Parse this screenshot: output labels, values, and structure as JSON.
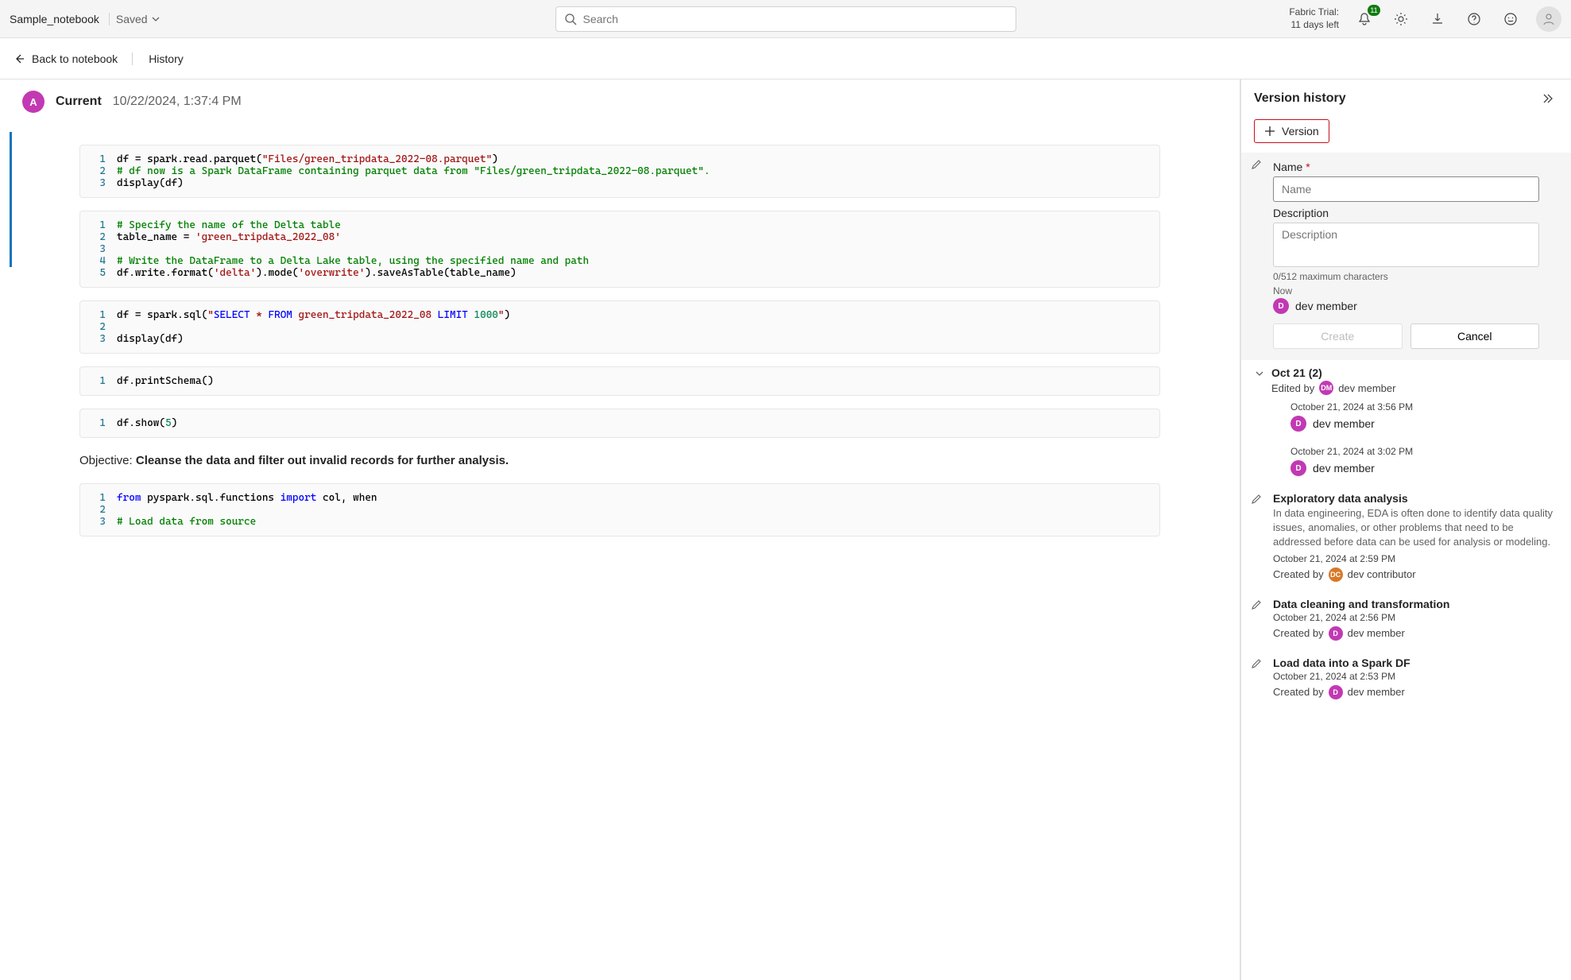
{
  "header": {
    "title": "Sample_notebook",
    "saved_label": "Saved",
    "search_placeholder": "Search",
    "trial_line1": "Fabric Trial:",
    "trial_line2": "11 days left",
    "notification_count": "11"
  },
  "secondary": {
    "back_label": "Back to notebook",
    "history_label": "History"
  },
  "current_version": {
    "avatar_letter": "A",
    "name": "Current",
    "timestamp": "10/22/2024, 1:37:4 PM"
  },
  "cells": [
    {
      "type": "code",
      "lines": [
        [
          {
            "t": "",
            "c": "df = spark.read.parquet("
          },
          {
            "t": "s",
            "c": "\"Files/green_tripdata_2022-08.parquet\""
          },
          {
            "t": "",
            "c": ")"
          }
        ],
        [
          {
            "t": "cm",
            "c": "# df now is a Spark DataFrame containing parquet data from \"Files/green_tripdata_2022-08.parquet\"."
          }
        ],
        [
          {
            "t": "",
            "c": "display(df)"
          }
        ]
      ]
    },
    {
      "type": "code",
      "lines": [
        [
          {
            "t": "cm",
            "c": "# Specify the name of the Delta table"
          }
        ],
        [
          {
            "t": "",
            "c": "table_name = "
          },
          {
            "t": "s",
            "c": "'green_tripdata_2022_08'"
          }
        ],
        [
          {
            "t": "",
            "c": ""
          }
        ],
        [
          {
            "t": "cm",
            "c": "# Write the DataFrame to a Delta Lake table, using the specified name and path"
          }
        ],
        [
          {
            "t": "",
            "c": "df.write.format("
          },
          {
            "t": "s",
            "c": "'delta'"
          },
          {
            "t": "",
            "c": ").mode("
          },
          {
            "t": "s",
            "c": "'overwrite'"
          },
          {
            "t": "",
            "c": ").saveAsTable(table_name)"
          }
        ]
      ]
    },
    {
      "type": "code",
      "lines": [
        [
          {
            "t": "",
            "c": "df = spark.sql("
          },
          {
            "t": "s",
            "c": "\""
          },
          {
            "t": "kw",
            "c": "SELECT"
          },
          {
            "t": "s",
            "c": " * "
          },
          {
            "t": "kw",
            "c": "FROM"
          },
          {
            "t": "s",
            "c": " green_tripdata_2022_08 "
          },
          {
            "t": "kw",
            "c": "LIMIT"
          },
          {
            "t": "s",
            "c": " "
          },
          {
            "t": "n",
            "c": "1000"
          },
          {
            "t": "s",
            "c": "\""
          },
          {
            "t": "",
            "c": ")"
          }
        ],
        [
          {
            "t": "",
            "c": ""
          }
        ],
        [
          {
            "t": "",
            "c": "display(df)"
          }
        ]
      ]
    },
    {
      "type": "code",
      "lines": [
        [
          {
            "t": "",
            "c": "df.printSchema()"
          }
        ]
      ]
    },
    {
      "type": "code",
      "lines": [
        [
          {
            "t": "",
            "c": "df.show("
          },
          {
            "t": "n",
            "c": "5"
          },
          {
            "t": "",
            "c": ")"
          }
        ]
      ]
    },
    {
      "type": "md",
      "objective_label": "Objective: ",
      "objective_value": "Cleanse the data and filter out invalid records for further analysis."
    },
    {
      "type": "code",
      "lines": [
        [
          {
            "t": "kw",
            "c": "from"
          },
          {
            "t": "",
            "c": " pyspark.sql.functions "
          },
          {
            "t": "kw",
            "c": "import"
          },
          {
            "t": "",
            "c": " col, when"
          }
        ],
        [
          {
            "t": "",
            "c": ""
          }
        ],
        [
          {
            "t": "cm",
            "c": "# Load data from source"
          }
        ]
      ]
    }
  ],
  "sidebar": {
    "title": "Version history",
    "add_version_label": "Version",
    "form": {
      "name_label": "Name",
      "name_placeholder": "Name",
      "desc_label": "Description",
      "desc_placeholder": "Description",
      "counter": "0/512 maximum characters",
      "now_label": "Now",
      "author_initial": "D",
      "author_name": "dev member",
      "create_label": "Create",
      "cancel_label": "Cancel"
    },
    "group": {
      "title": "Oct 21 (2)",
      "edited_by_label": "Edited by",
      "edited_initial": "DM",
      "edited_name": "dev member",
      "items": [
        {
          "ts": "October 21, 2024 at 3:56 PM",
          "initial": "D",
          "author": "dev member"
        },
        {
          "ts": "October 21, 2024 at 3:02 PM",
          "initial": "D",
          "author": "dev member"
        }
      ]
    },
    "named_versions": [
      {
        "title": "Exploratory data analysis",
        "desc": "In data engineering, EDA is often done to identify data quality issues, anomalies, or other problems that need to be addressed before data can be used for analysis or modeling.",
        "ts": "October 21, 2024 at 2:59 PM",
        "created_by_label": "Created by",
        "initial": "DC",
        "author": "dev contributor",
        "avatar_class": "av-orange"
      },
      {
        "title": "Data cleaning and transformation",
        "desc": "",
        "ts": "October 21, 2024 at 2:56 PM",
        "created_by_label": "Created by",
        "initial": "D",
        "author": "dev member",
        "avatar_class": "av-magenta"
      },
      {
        "title": "Load data into a Spark DF",
        "desc": "",
        "ts": "October 21, 2024 at 2:53 PM",
        "created_by_label": "Created by",
        "initial": "D",
        "author": "dev member",
        "avatar_class": "av-magenta"
      }
    ]
  }
}
